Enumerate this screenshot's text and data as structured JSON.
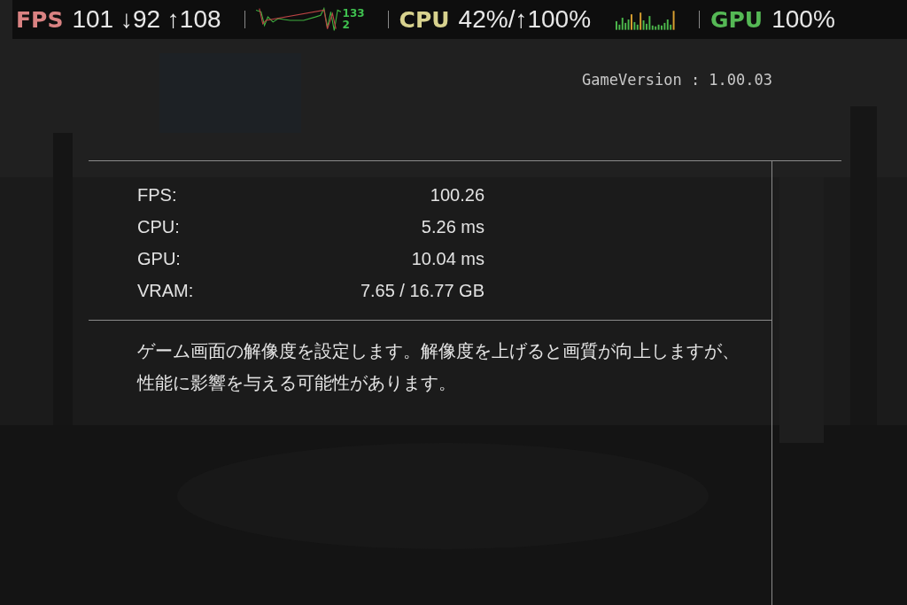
{
  "overlay": {
    "fps": {
      "label": "FPS",
      "reading": "101 ↓92 ↑108",
      "graph_max": "133",
      "graph_min": "2"
    },
    "cpu": {
      "label": "CPU",
      "reading": "42%/↑100%"
    },
    "gpu": {
      "label": "GPU",
      "reading": "100%"
    }
  },
  "game_version": "GameVersion : 1.00.03",
  "stats": [
    {
      "label": "FPS:",
      "value": "100.26"
    },
    {
      "label": "CPU:",
      "value": "5.26 ms"
    },
    {
      "label": "GPU:",
      "value": "10.04 ms"
    },
    {
      "label": "VRAM:",
      "value": "7.65 / 16.77 GB"
    }
  ],
  "description": "ゲーム画面の解像度を設定します。解像度を上げると画質が向上しますが、性能に影響を与える可能性があります。"
}
